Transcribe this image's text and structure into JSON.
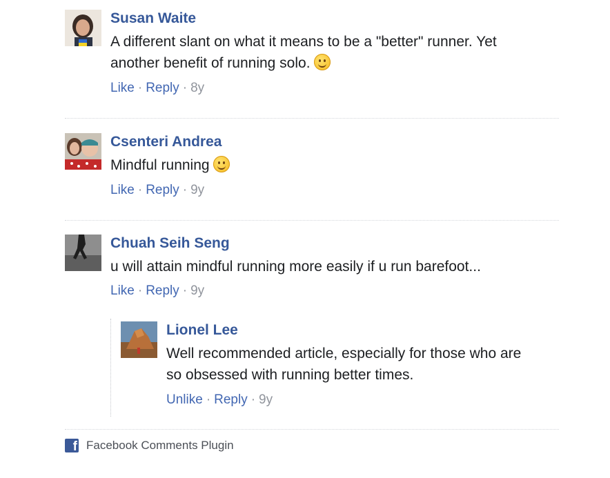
{
  "comments": [
    {
      "author": "Susan Waite",
      "lines": [
        "A different slant on what it means to be a \"better\" runner. Yet",
        "another benefit of running solo."
      ],
      "emoji": "slightly-smiling-face",
      "actions": {
        "like": "Like",
        "reply": "Reply",
        "sep": "·",
        "time": "8y"
      }
    },
    {
      "author": "Csenteri Andrea",
      "lines": [
        "Mindful running"
      ],
      "emoji": "slightly-smiling-face",
      "actions": {
        "like": "Like",
        "reply": "Reply",
        "sep": "·",
        "time": "9y"
      }
    },
    {
      "author": "Chuah Seih Seng",
      "lines": [
        "u will attain mindful running more easily if u run barefoot..."
      ],
      "actions": {
        "like": "Like",
        "reply": "Reply",
        "sep": "·",
        "time": "9y"
      },
      "replies": [
        {
          "author": "Lionel Lee",
          "lines": [
            "Well recommended article, especially for those who are",
            "so obsessed with running better times."
          ],
          "actions": {
            "like": "Unlike",
            "reply": "Reply",
            "sep": "·",
            "time": "9y"
          }
        }
      ]
    }
  ],
  "footer": {
    "label": "Facebook Comments Plugin",
    "icon": "facebook-icon"
  },
  "colors": {
    "link": "#4267b2",
    "author": "#365899",
    "meta": "#90949c",
    "brand": "#3b5998"
  }
}
